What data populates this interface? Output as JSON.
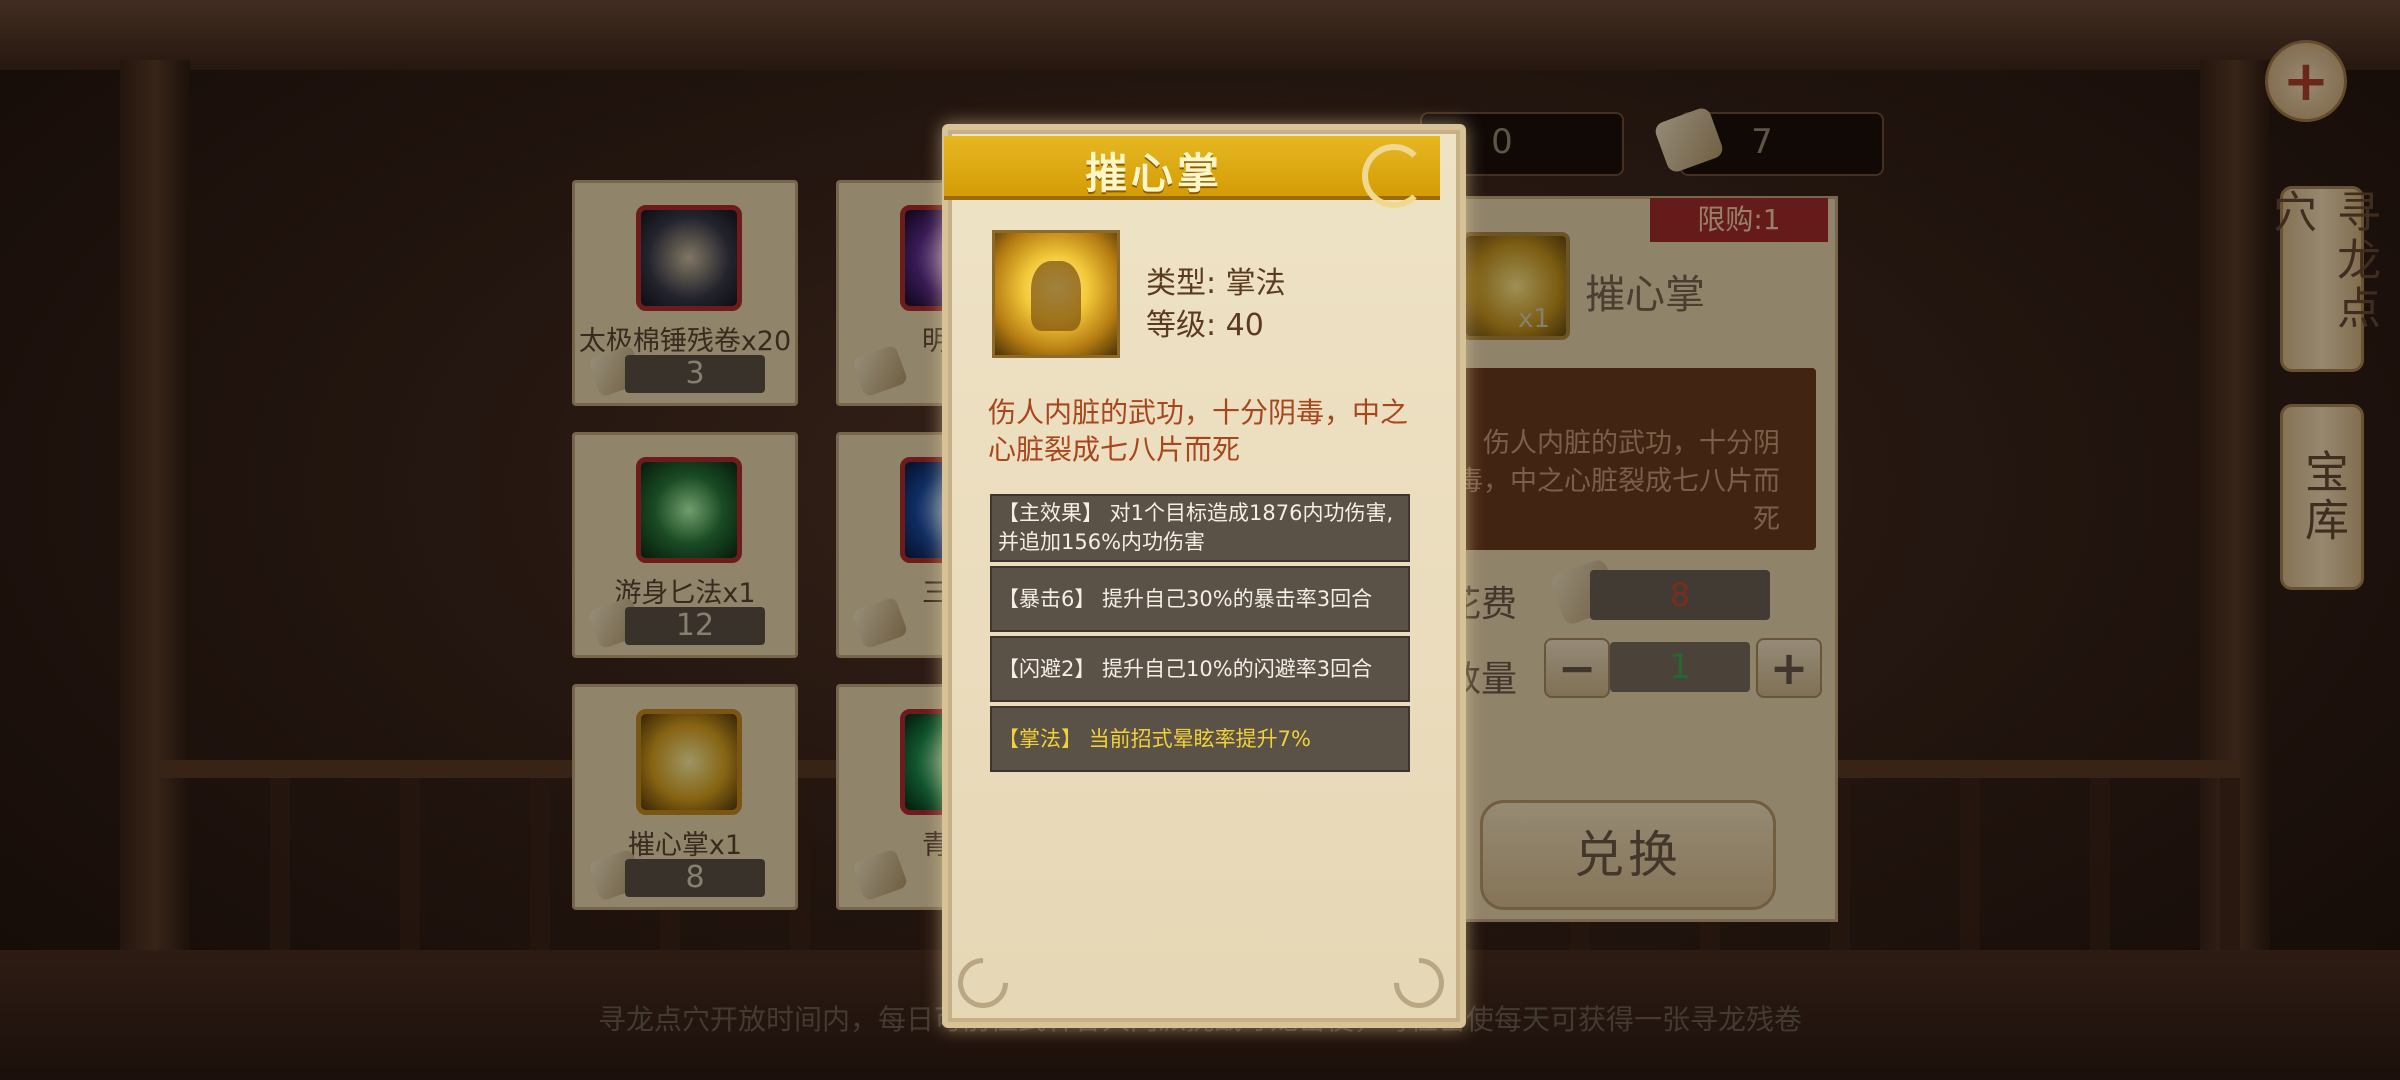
{
  "colors": {
    "popup_header": "#d9a60c",
    "limit_badge": "#a52d2d",
    "effect_gold": "#f0d13a",
    "desc_red": "#a8461e"
  },
  "currency": [
    {
      "icon": "scroll-icon",
      "value": "0"
    },
    {
      "icon": "scroll-icon",
      "value": "7"
    }
  ],
  "side_tabs": [
    {
      "label": "寻龙点穴"
    },
    {
      "label": "宝库"
    }
  ],
  "items": [
    {
      "name": "太极棉锤残卷x20",
      "count": "3",
      "icon": "hammer-scroll-icon"
    },
    {
      "name": "明王",
      "count": "",
      "icon": "purple-skill-icon"
    },
    {
      "name": "游身匕法x1",
      "count": "12",
      "icon": "green-skill-icon"
    },
    {
      "name": "三更",
      "count": "",
      "icon": "blue-skill-icon"
    },
    {
      "name": "摧心掌x1",
      "count": "8",
      "icon": "palm-skill-icon"
    },
    {
      "name": "青山",
      "count": "",
      "icon": "green-swirl-icon"
    }
  ],
  "detail": {
    "limit": "限购:1",
    "name": "摧心掌",
    "qty_badge": "x1",
    "desc": "伤人内脏的武功，十分阴毒，中之心脏裂成七八片而死",
    "cost_label": "花费",
    "cost_value": "8",
    "qty_label": "数量",
    "qty_value": "1",
    "minus": "−",
    "plus": "+",
    "exchange": "兑换"
  },
  "bottom_tip": "寻龙点穴开放时间内，每日可前往武林各大门派挑战寻龙密使，每位密使每天可获得一张寻龙残卷",
  "popup": {
    "title": "摧心掌",
    "type": "类型: 掌法",
    "level": "等级: 40",
    "desc": "伤人内脏的武功，十分阴毒，中之心脏裂成七八片而死",
    "effects": [
      "【主效果】 对1个目标造成1876内功伤害,并追加156%内功伤害",
      "【暴击6】 提升自己30%的暴击率3回合",
      "【闪避2】 提升自己10%的闪避率3回合",
      "【掌法】 当前招式晕眩率提升7%"
    ]
  }
}
